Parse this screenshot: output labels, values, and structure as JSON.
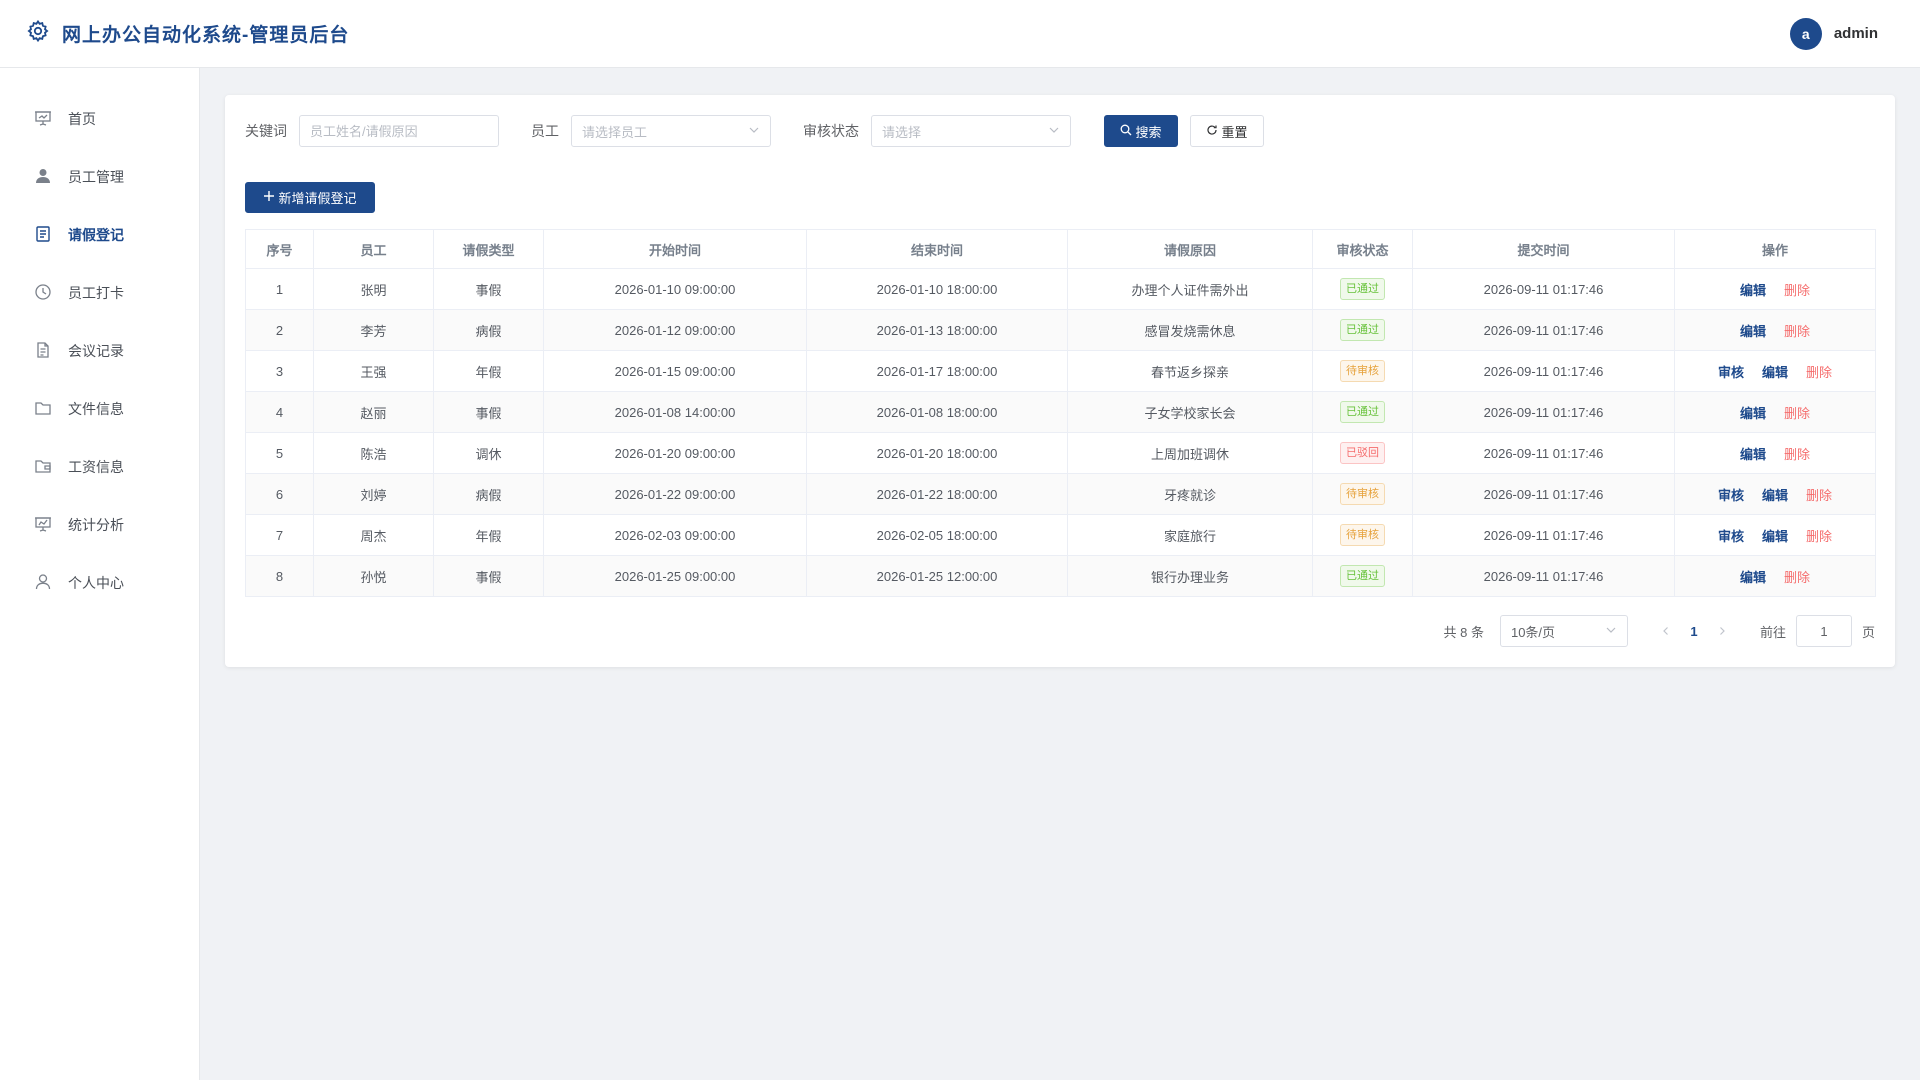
{
  "header": {
    "title": "网上办公自动化系统-管理员后台",
    "avatar_letter": "a",
    "username": "admin"
  },
  "sidebar": {
    "items": [
      {
        "label": "首页",
        "icon": "presentation-icon"
      },
      {
        "label": "员工管理",
        "icon": "user-icon"
      },
      {
        "label": "请假登记",
        "icon": "document-icon",
        "active": true
      },
      {
        "label": "员工打卡",
        "icon": "clock-icon"
      },
      {
        "label": "会议记录",
        "icon": "notes-icon"
      },
      {
        "label": "文件信息",
        "icon": "folder-icon"
      },
      {
        "label": "工资信息",
        "icon": "wallet-folder-icon"
      },
      {
        "label": "统计分析",
        "icon": "chart-board-icon"
      },
      {
        "label": "个人中心",
        "icon": "user-outline-icon"
      }
    ]
  },
  "search": {
    "keyword_label": "关键词",
    "keyword_placeholder": "员工姓名/请假原因",
    "employee_label": "员工",
    "employee_placeholder": "请选择员工",
    "status_label": "审核状态",
    "status_placeholder": "请选择",
    "search_button": "搜索",
    "reset_button": "重置"
  },
  "add_button": "新增请假登记",
  "table": {
    "columns": [
      "序号",
      "员工",
      "请假类型",
      "开始时间",
      "结束时间",
      "请假原因",
      "审核状态",
      "提交时间",
      "操作"
    ],
    "rows": [
      {
        "no": "1",
        "employee": "张明",
        "type": "事假",
        "start": "2026-01-10 09:00:00",
        "end": "2026-01-10 18:00:00",
        "reason": "办理个人证件需外出",
        "status": "已通过",
        "status_kind": "pass",
        "submitted": "2026-09-11 01:17:46"
      },
      {
        "no": "2",
        "employee": "李芳",
        "type": "病假",
        "start": "2026-01-12 09:00:00",
        "end": "2026-01-13 18:00:00",
        "reason": "感冒发烧需休息",
        "status": "已通过",
        "status_kind": "pass",
        "submitted": "2026-09-11 01:17:46"
      },
      {
        "no": "3",
        "employee": "王强",
        "type": "年假",
        "start": "2026-01-15 09:00:00",
        "end": "2026-01-17 18:00:00",
        "reason": "春节返乡探亲",
        "status": "待审核",
        "status_kind": "wait",
        "submitted": "2026-09-11 01:17:46"
      },
      {
        "no": "4",
        "employee": "赵丽",
        "type": "事假",
        "start": "2026-01-08 14:00:00",
        "end": "2026-01-08 18:00:00",
        "reason": "子女学校家长会",
        "status": "已通过",
        "status_kind": "pass",
        "submitted": "2026-09-11 01:17:46"
      },
      {
        "no": "5",
        "employee": "陈浩",
        "type": "调休",
        "start": "2026-01-20 09:00:00",
        "end": "2026-01-20 18:00:00",
        "reason": "上周加班调休",
        "status": "已驳回",
        "status_kind": "reject",
        "submitted": "2026-09-11 01:17:46"
      },
      {
        "no": "6",
        "employee": "刘婷",
        "type": "病假",
        "start": "2026-01-22 09:00:00",
        "end": "2026-01-22 18:00:00",
        "reason": "牙疼就诊",
        "status": "待审核",
        "status_kind": "wait",
        "submitted": "2026-09-11 01:17:46"
      },
      {
        "no": "7",
        "employee": "周杰",
        "type": "年假",
        "start": "2026-02-03 09:00:00",
        "end": "2026-02-05 18:00:00",
        "reason": "家庭旅行",
        "status": "待审核",
        "status_kind": "wait",
        "submitted": "2026-09-11 01:17:46"
      },
      {
        "no": "8",
        "employee": "孙悦",
        "type": "事假",
        "start": "2026-01-25 09:00:00",
        "end": "2026-01-25 12:00:00",
        "reason": "银行办理业务",
        "status": "已通过",
        "status_kind": "pass",
        "submitted": "2026-09-11 01:17:46"
      }
    ],
    "actions": {
      "review": "审核",
      "edit": "编辑",
      "delete": "删除"
    }
  },
  "pagination": {
    "total_text": "共 8 条",
    "page_size": "10条/页",
    "current_page": "1",
    "goto_label": "前往",
    "goto_value": "1",
    "page_suffix": "页"
  },
  "colors": {
    "primary": "#1e4a8c",
    "success": "#67c23a",
    "warning": "#e6a23c",
    "danger": "#f56c6c"
  }
}
